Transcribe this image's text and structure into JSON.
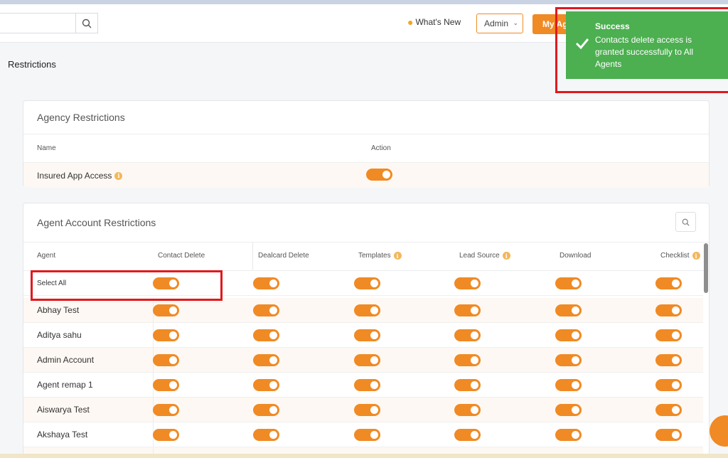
{
  "topbar": {
    "whats_new": "What's New",
    "admin_select": "Admin",
    "my_agency_button": "My Ag"
  },
  "toast": {
    "title": "Success",
    "message": "Contacts delete access is granted successfully to All Agents"
  },
  "page": {
    "title": "Restrictions"
  },
  "agency_restrictions": {
    "title": "Agency Restrictions",
    "columns": [
      "Name",
      "Action"
    ],
    "rows": [
      {
        "name": "Insured App Access",
        "enabled": true
      }
    ]
  },
  "agent_restrictions": {
    "title": "Agent Account Restrictions",
    "columns": [
      "Agent",
      "Contact Delete",
      "Dealcard Delete",
      "Templates",
      "Lead Source",
      "Download",
      "Checklist"
    ],
    "select_all_label": "Select All",
    "rows": [
      {
        "name": "Abhay Test"
      },
      {
        "name": "Aditya sahu"
      },
      {
        "name": "Admin Account"
      },
      {
        "name": "Agent remap 1"
      },
      {
        "name": "Aiswarya Test"
      },
      {
        "name": "Akshaya Test"
      }
    ],
    "toggle_state": "on"
  },
  "colors": {
    "accent": "#f08a24",
    "success": "#4caf50",
    "highlight": "#e0191e"
  }
}
